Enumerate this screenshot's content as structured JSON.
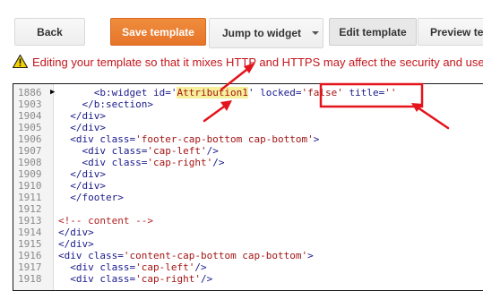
{
  "toolbar": {
    "back_label": "Back",
    "save_label": "Save template",
    "jump_label": "Jump to widget",
    "edit_label": "Edit template",
    "preview_label": "Preview te"
  },
  "warning": {
    "text": "Editing your template so that it mixes HTTP and HTTPS may affect the security and use"
  },
  "editor": {
    "lines": [
      {
        "n": "1886",
        "t": "      <b:widget id='Attribution1' locked='false' title=''"
      },
      {
        "n": "1903",
        "t": "    </b:section>"
      },
      {
        "n": "1904",
        "t": "  </div>"
      },
      {
        "n": "1905",
        "t": "  </div>"
      },
      {
        "n": "1906",
        "t": "  <div class='footer-cap-bottom cap-bottom'>"
      },
      {
        "n": "1907",
        "t": "    <div class='cap-left'/>"
      },
      {
        "n": "1908",
        "t": "    <div class='cap-right'/>"
      },
      {
        "n": "1909",
        "t": "  </div>"
      },
      {
        "n": "1910",
        "t": "  </div>"
      },
      {
        "n": "1911",
        "t": "  </footer>"
      },
      {
        "n": "1912",
        "t": ""
      },
      {
        "n": "1913",
        "t": "<!-- content -->"
      },
      {
        "n": "1914",
        "t": "</div>"
      },
      {
        "n": "1915",
        "t": "</div>"
      },
      {
        "n": "1916",
        "t": "<div class='content-cap-bottom cap-bottom'>"
      },
      {
        "n": "1917",
        "t": "  <div class='cap-left'/>"
      },
      {
        "n": "1918",
        "t": "  <div class='cap-right'/>"
      }
    ]
  },
  "colors": {
    "save_button": "#e7742a",
    "warning_text": "#c4161c",
    "annotation_red": "#e3141b",
    "highlight": "#f7f09a"
  }
}
